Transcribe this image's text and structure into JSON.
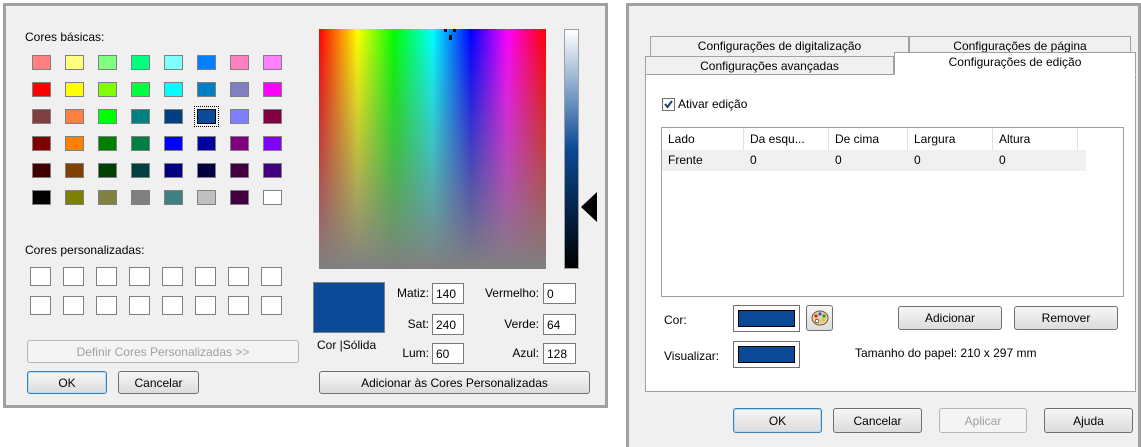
{
  "color_dialog": {
    "basic_colors_label": "Cores básicas:",
    "basic_colors": [
      [
        "#ff8080",
        "#ffff80",
        "#80ff80",
        "#00ff80",
        "#80ffff",
        "#0080ff",
        "#ff80c0",
        "#ff80ff"
      ],
      [
        "#ff0000",
        "#ffff00",
        "#80ff00",
        "#00ff40",
        "#00ffff",
        "#0080c0",
        "#8080c0",
        "#ff00ff"
      ],
      [
        "#804040",
        "#ff8040",
        "#00ff00",
        "#008080",
        "#004080",
        "#0a4a96",
        "#8080ff",
        "#800040"
      ],
      [
        "#800000",
        "#ff8000",
        "#008000",
        "#008040",
        "#0000ff",
        "#0000a0",
        "#800080",
        "#8000ff"
      ],
      [
        "#400000",
        "#804000",
        "#004000",
        "#004040",
        "#000080",
        "#000040",
        "#400040",
        "#400080"
      ],
      [
        "#000000",
        "#808000",
        "#808040",
        "#808080",
        "#408080",
        "#c0c0c0",
        "#400040",
        "#ffffff"
      ]
    ],
    "custom_colors_label": "Cores personalizadas:",
    "define_custom_label": "Definir Cores Personalizadas >>",
    "ok_label": "OK",
    "cancel_label": "Cancelar",
    "color_solid_label": "Cor  |Sólida",
    "selected_color": "#0a4a96",
    "hue_label": "Matiz:",
    "hue_value": "140",
    "sat_label": "Sat:",
    "sat_value": "240",
    "lum_label": "Lum:",
    "lum_value": "60",
    "red_label": "Vermelho:",
    "red_value": "0",
    "green_label": "Verde:",
    "green_value": "64",
    "blue_label": "Azul:",
    "blue_value": "128",
    "add_custom_label": "Adicionar às Cores Personalizadas"
  },
  "edit_dialog": {
    "tabs_back": [
      "Configurações de digitalização",
      "Configurações de página"
    ],
    "tabs_front": [
      "Configurações avançadas",
      "Configurações de edição"
    ],
    "enable_edit_label": "Ativar edição",
    "enable_edit_checked": true,
    "columns": [
      "Lado",
      "Da esqu...",
      "De cima",
      "Largura",
      "Altura"
    ],
    "rows": [
      [
        "Frente",
        "0",
        "0",
        "0",
        "0"
      ]
    ],
    "color_label": "Cor:",
    "add_label": "Adicionar",
    "remove_label": "Remover",
    "preview_label": "Visualizar:",
    "paper_size_label": "Tamanho do papel: 210 x 297 mm",
    "ok_label": "OK",
    "cancel_label": "Cancelar",
    "apply_label": "Aplicar",
    "help_label": "Ajuda",
    "palette_icon": "palette-icon"
  }
}
